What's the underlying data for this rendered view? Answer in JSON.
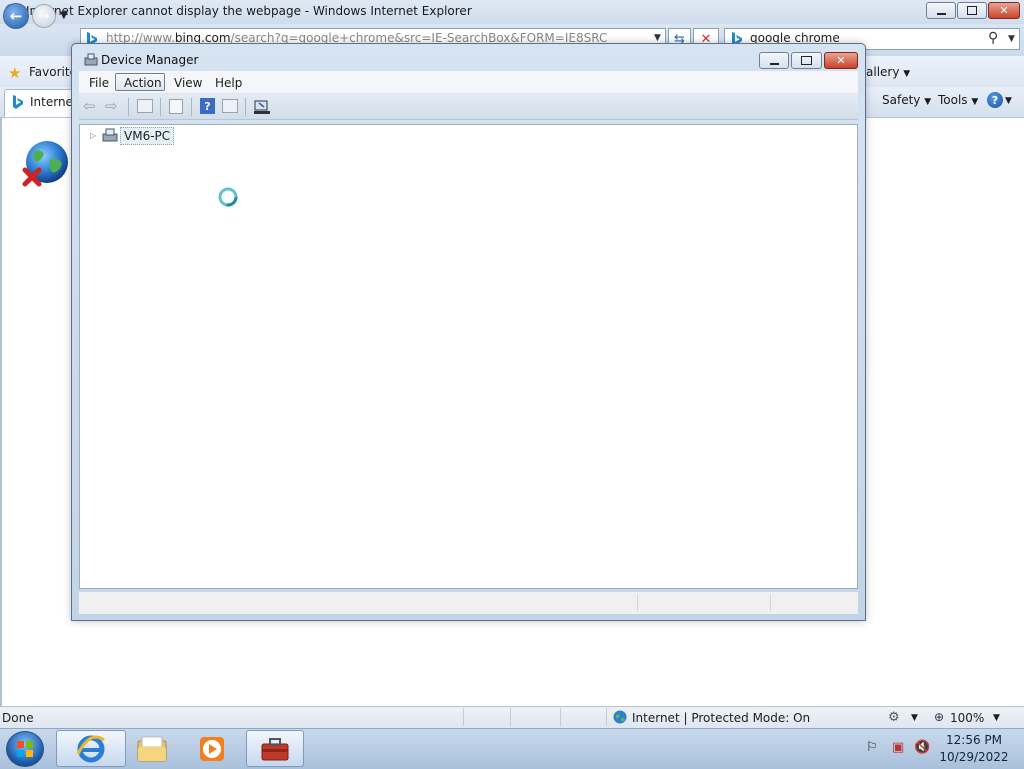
{
  "ie": {
    "title": "Internet Explorer cannot display the webpage - Windows Internet Explorer",
    "address_prefix": "http://www.",
    "address_host": "bing.com",
    "address_rest": "/search?q=google+chrome&src=IE-SearchBox&FORM=IE8SRC",
    "search_text": "google chrome",
    "favorites_label": "Favorite",
    "gallery_label": "allery",
    "tab_label": "Internet",
    "cmd": {
      "safety": "Safety",
      "tools": "Tools",
      "help_glyph": "?"
    },
    "status": {
      "done": "Done",
      "zone": "Internet | Protected Mode: On",
      "zoom": "100%"
    }
  },
  "device_manager": {
    "title": "Device Manager",
    "menu": [
      "File",
      "Action",
      "View",
      "Help"
    ],
    "tree_root": "VM6-PC"
  },
  "taskbar": {
    "time": "12:56 PM",
    "date": "10/29/2022"
  },
  "icons": [
    "ie-logo-icon",
    "back-arrow-icon",
    "forward-arrow-icon",
    "bing-icon",
    "refresh-icon",
    "stop-icon",
    "search-icon",
    "favorites-star-icon",
    "help-icon",
    "globe-error-icon",
    "internet-zone-globe-icon",
    "zoom-icon",
    "start-orb-icon",
    "folder-icon",
    "media-player-icon",
    "toolbox-icon",
    "flag-icon",
    "network-error-icon",
    "volume-muted-icon",
    "computer-icon",
    "busy-cursor-icon"
  ]
}
